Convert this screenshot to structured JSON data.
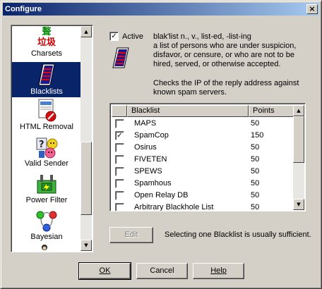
{
  "window": {
    "title": "Configure",
    "close_symbol": "×"
  },
  "sidebar": {
    "items": [
      {
        "label": "Charsets",
        "icon": "charset-icon",
        "glyph_top": "聱",
        "glyph_bottom": "垃圾"
      },
      {
        "label": "Blacklists",
        "icon": "blacklist-icon",
        "selected": true
      },
      {
        "label": "HTML Removal",
        "icon": "html-removal-icon"
      },
      {
        "label": "Valid Sender",
        "icon": "valid-sender-icon"
      },
      {
        "label": "Power Filter",
        "icon": "power-filter-icon"
      },
      {
        "label": "Bayesian",
        "icon": "bayesian-icon"
      }
    ]
  },
  "active": {
    "label": "Active",
    "checked": true
  },
  "definition": {
    "headword": "blak'list n., v., list-ed, -list-ing",
    "lines": [
      "a list of persons who are under suspicion,",
      "disfavor, or censure, or who are not to be",
      "hired, served, or otherwise accepted."
    ]
  },
  "description_lines": [
    "Checks the IP of the reply address against",
    "known spam servers."
  ],
  "blacklist_table": {
    "columns": [
      "Blacklist",
      "Points"
    ],
    "rows": [
      {
        "name": "MAPS",
        "points": "50",
        "checked": false
      },
      {
        "name": "SpamCop",
        "points": "150",
        "checked": true
      },
      {
        "name": "Osirus",
        "points": "50",
        "checked": false
      },
      {
        "name": "FIVETEN",
        "points": "50",
        "checked": false
      },
      {
        "name": "SPEWS",
        "points": "50",
        "checked": false
      },
      {
        "name": "Spamhous",
        "points": "50",
        "checked": false
      },
      {
        "name": "Open Relay DB",
        "points": "50",
        "checked": false
      },
      {
        "name": "Arbitrary Blackhole List",
        "points": "50",
        "checked": false
      }
    ]
  },
  "edit_button": "Edit",
  "hint": "Selecting one Blacklist is usually sufficient.",
  "buttons": {
    "ok": "OK",
    "cancel": "Cancel",
    "help": "Help"
  },
  "check_mark": "✓",
  "colors": {
    "title_start": "#0a246a",
    "title_end": "#a6caf0",
    "selection": "#0a246a",
    "face": "#d4d0c8"
  }
}
